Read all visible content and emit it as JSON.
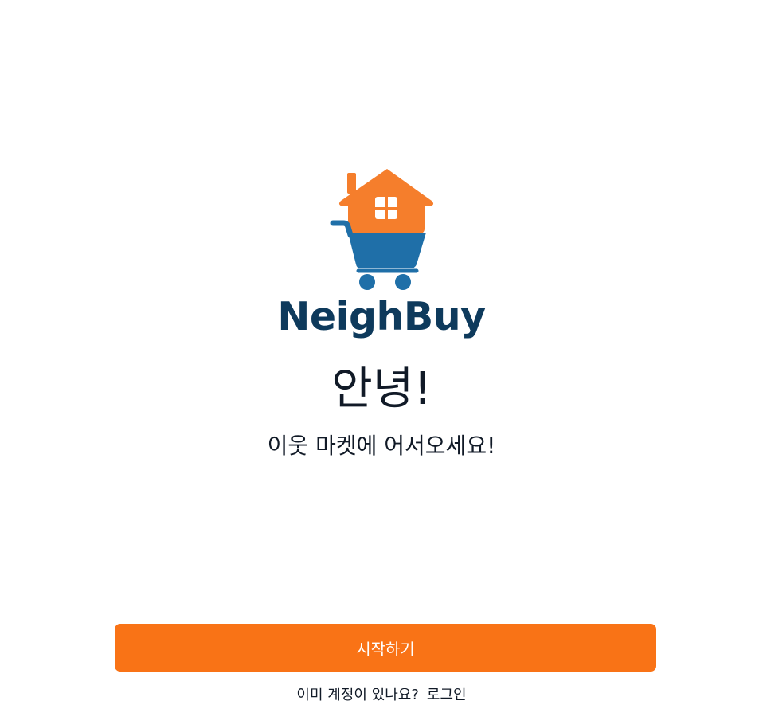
{
  "brand": {
    "name": "NeighBuy",
    "name_color": "#0e3a5c",
    "logo_icon": "house-shopping-cart-icon",
    "house_color": "#f57e2c",
    "cart_color": "#1f6fa8"
  },
  "welcome": {
    "greeting": "안녕!",
    "subtitle": "이웃 마켓에 어서오세요!"
  },
  "actions": {
    "start_label": "시작하기",
    "start_color": "#f97316",
    "login_prompt": "이미 계정이 있나요?",
    "login_label": "로그인"
  }
}
